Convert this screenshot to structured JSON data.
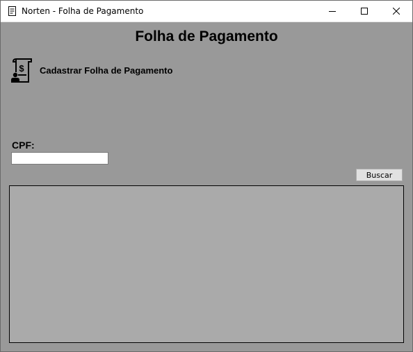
{
  "window": {
    "title": "Norten - Folha de Pagamento",
    "background_color": "#999999",
    "controls": {
      "minimize_icon": "minimize-icon",
      "maximize_icon": "maximize-icon",
      "close_icon": "close-icon"
    }
  },
  "header": {
    "title": "Folha de Pagamento"
  },
  "actions": {
    "register_label": "Cadastrar Folha de Pagamento",
    "register_icon": "payroll-document-icon"
  },
  "search": {
    "cpf_label": "CPF:",
    "cpf_value": "",
    "button_label": "Buscar"
  },
  "results": {
    "grid_background": "#aaaaaa"
  }
}
